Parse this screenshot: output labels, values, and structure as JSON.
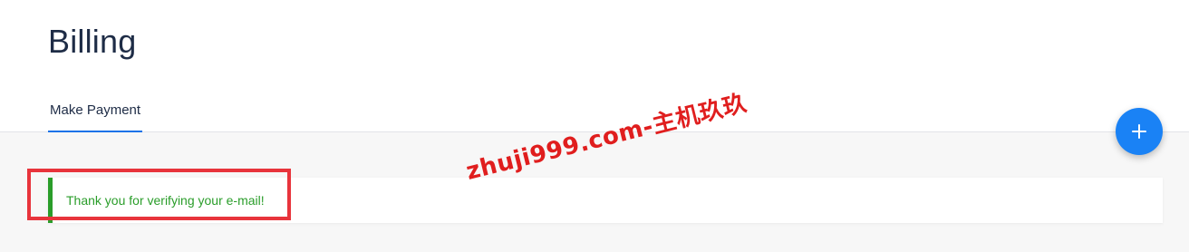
{
  "page": {
    "title": "Billing"
  },
  "tabs": [
    {
      "label": "Make Payment",
      "active": true
    }
  ],
  "fab": {
    "icon": "plus-icon",
    "color": "#1a82f5"
  },
  "alert": {
    "message": "Thank you for verifying your e-mail!",
    "type": "success",
    "color": "#2a9d2a"
  },
  "annotation": {
    "highlight_color": "#e8343c"
  },
  "watermark": {
    "text": "zhuji999.com-主机玖玖"
  }
}
